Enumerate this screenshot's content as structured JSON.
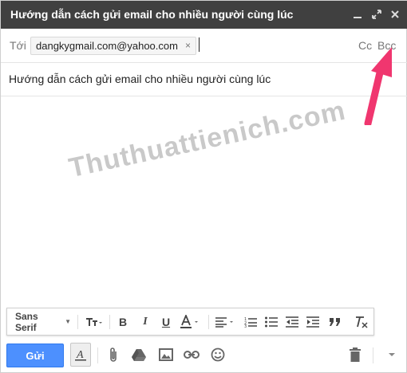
{
  "window": {
    "title": "Hướng dẫn cách gửi email cho nhiều người cùng lúc"
  },
  "recipients": {
    "to_label": "Tới",
    "chips": [
      {
        "email": "dangkygmail.com@yahoo.com",
        "remove": "×"
      }
    ],
    "cc_label": "Cc",
    "bcc_label": "Bcc"
  },
  "subject": {
    "value": "Hướng dẫn cách gửi email cho nhiều người cùng lúc"
  },
  "body": {
    "watermark": "Thuthuattienich.com"
  },
  "formatting": {
    "font_family": "Sans Serif",
    "tools": [
      "font-size-icon",
      "bold-icon",
      "italic-icon",
      "underline-icon",
      "text-color-icon",
      "align-icon",
      "numbered-list-icon",
      "bulleted-list-icon",
      "indent-less-icon",
      "indent-more-icon",
      "quote-icon",
      "clear-formatting-icon"
    ]
  },
  "bottom_bar": {
    "send_label": "Gửi"
  },
  "colors": {
    "titlebar": "#404040",
    "send_button": "#4d90fe",
    "arrow": "#f0366f"
  }
}
